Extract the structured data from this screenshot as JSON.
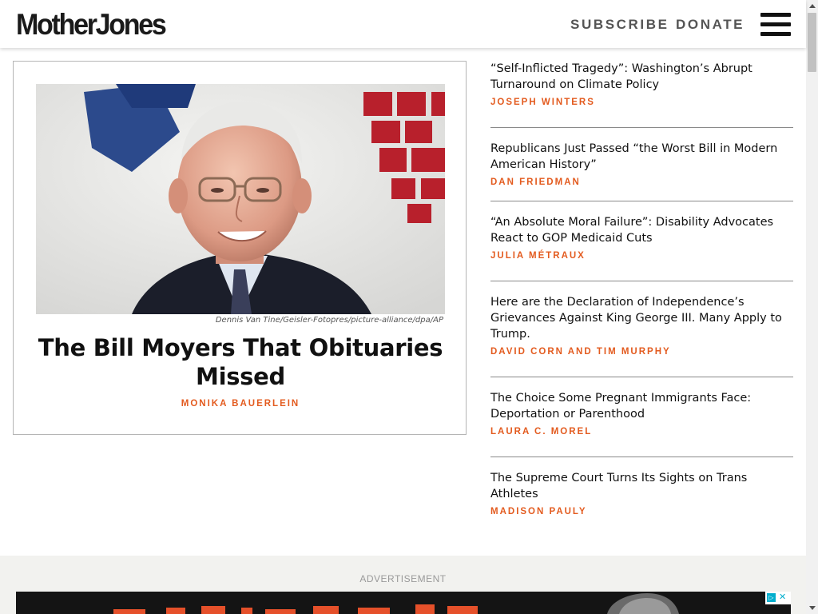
{
  "header": {
    "logo": "MotherJones",
    "nav": {
      "subscribe": "SUBSCRIBE",
      "donate": "DONATE"
    },
    "menu_icon": "hamburger-menu-icon"
  },
  "feature": {
    "image_credit": "Dennis Van Tine/Geisler-Fotopres/picture-alliance/dpa/AP",
    "title": "The Bill Moyers That Obituaries Missed",
    "author": "MONIKA BAUERLEIN"
  },
  "sidebar": {
    "stories": [
      {
        "title": "“Self-Inflicted Tragedy”: Washington’s Abrupt Turnaround on Climate Policy",
        "author": "JOSEPH WINTERS"
      },
      {
        "title": "Republicans Just Passed “the Worst Bill in Modern American History”",
        "author": "DAN FRIEDMAN"
      },
      {
        "title": "“An Absolute Moral Failure”: Disability Advocates React to GOP Medicaid Cuts",
        "author": "JULIA MÉTRAUX"
      },
      {
        "title": "Here are the Declaration of Independence’s Grievances Against King George III. Many Apply to Trump.",
        "author": "DAVID CORN AND TIM MURPHY"
      },
      {
        "title": "The Choice Some Pregnant Immigrants Face: Deportation or Parenthood",
        "author": "LAURA C. MOREL"
      },
      {
        "title": "The Supreme Court Turns Its Sights on Trans Athletes",
        "author": "MADISON PAULY"
      }
    ]
  },
  "ad": {
    "label": "ADVERTISEMENT",
    "choices_icon": "ad-choices-icon",
    "choices_glyph": "▷",
    "close_glyph": "✕"
  },
  "colors": {
    "accent": "#e35b1f",
    "text": "#111111",
    "ad_background": "#f2f2ef"
  }
}
